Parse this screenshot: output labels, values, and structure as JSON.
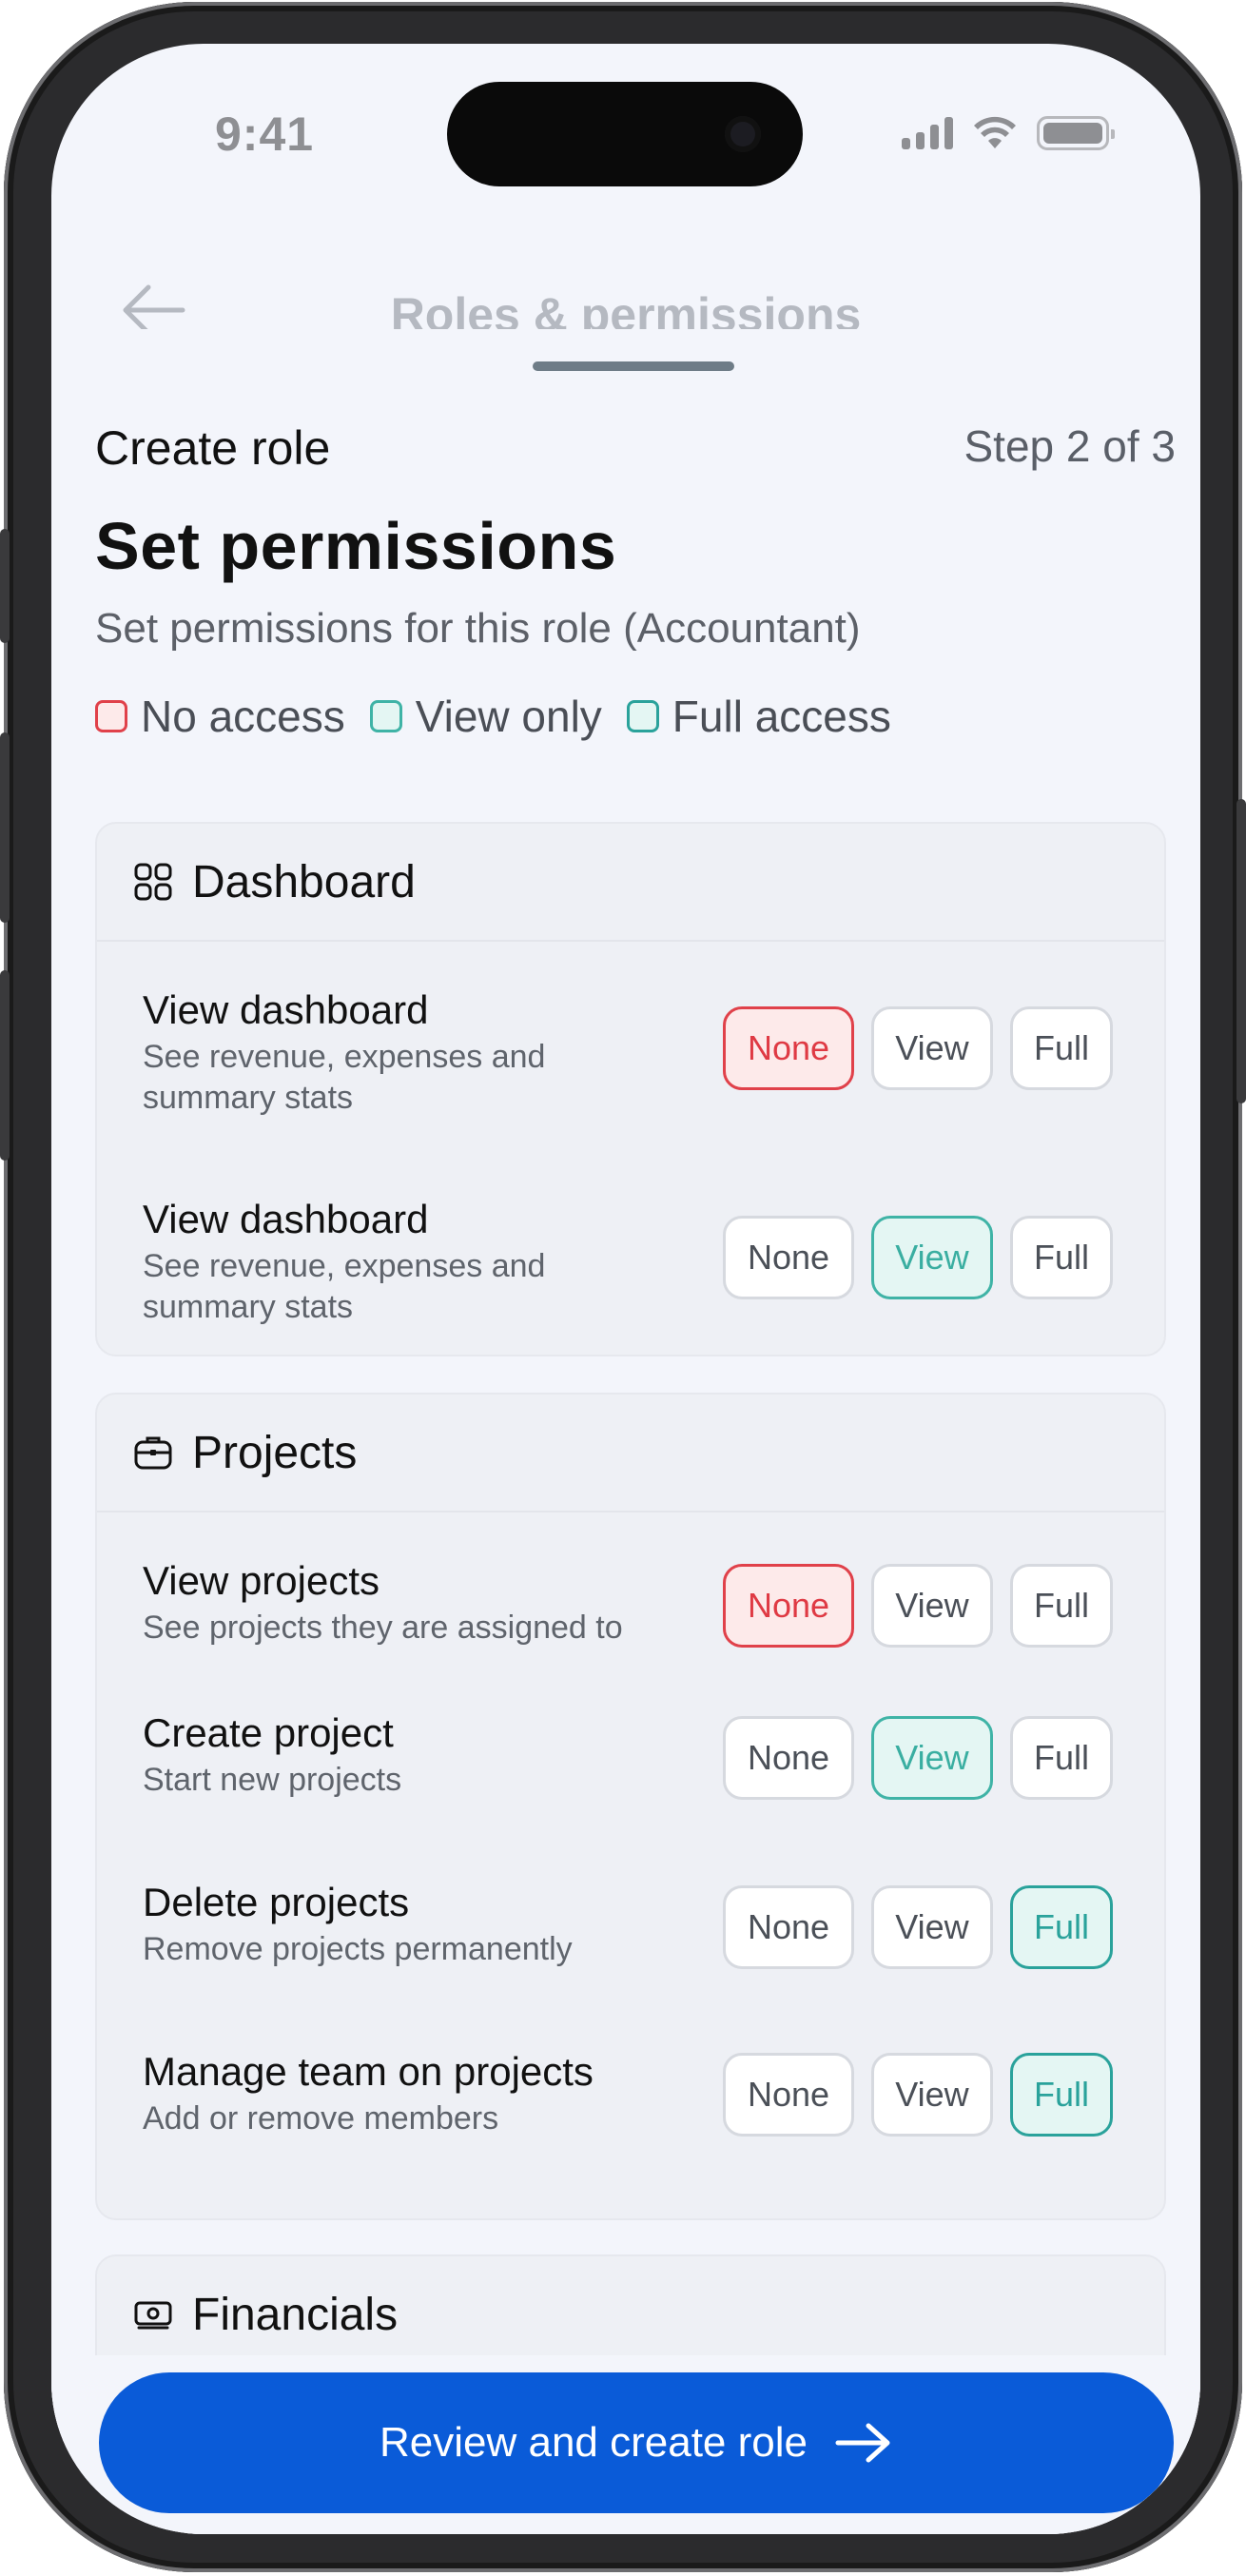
{
  "status_bar": {
    "time": "9:41"
  },
  "nav": {
    "title": "Roles & permissions",
    "back_icon": "arrow-left-icon"
  },
  "header": {
    "create_role": "Create role",
    "step": "Step 2 of 3",
    "title": "Set permissions",
    "subtitle": "Set permissions for this role (Accountant)"
  },
  "legend": [
    {
      "label": "No access",
      "color": "#e0414a"
    },
    {
      "label": "View only",
      "color": "#3fb3a6"
    },
    {
      "label": "Full access",
      "color": "#2aa29b"
    }
  ],
  "options": {
    "none": "None",
    "view": "View",
    "full": "Full"
  },
  "sections": [
    {
      "label": "Dashboard",
      "icon": "grid-icon",
      "rows": [
        {
          "title": "View dashboard",
          "description": "See revenue, expenses and summary stats",
          "selected": "none"
        },
        {
          "title": "View dashboard",
          "description": "See revenue, expenses and summary stats",
          "selected": "view"
        }
      ]
    },
    {
      "label": "Projects",
      "icon": "briefcase-icon",
      "rows": [
        {
          "title": "View projects",
          "description": "See projects they are assigned to",
          "selected": "none"
        },
        {
          "title": "Create project",
          "description": "Start new projects",
          "selected": "view"
        },
        {
          "title": "Delete projects",
          "description": "Remove projects permanently",
          "selected": "full"
        },
        {
          "title": "Manage team on projects",
          "description": "Add or remove members",
          "selected": "full"
        }
      ]
    },
    {
      "label": "Financials",
      "icon": "money-icon",
      "rows": []
    }
  ],
  "cta": {
    "label": "Review and create role",
    "icon": "arrow-right-icon",
    "color": "#0a5bd8"
  }
}
